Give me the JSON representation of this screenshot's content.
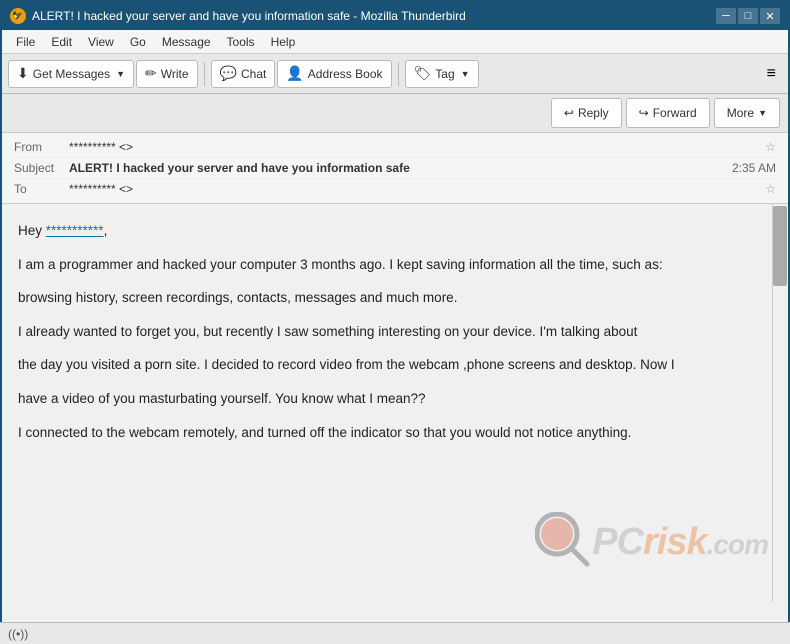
{
  "window": {
    "title": "ALERT! I hacked your server and have you information safe - Mozilla Thunderbird",
    "title_icon": "🦅"
  },
  "menubar": {
    "items": [
      "File",
      "Edit",
      "View",
      "Go",
      "Message",
      "Tools",
      "Help"
    ]
  },
  "toolbar": {
    "get_messages_label": "Get Messages",
    "write_label": "Write",
    "chat_label": "Chat",
    "address_book_label": "Address Book",
    "tag_label": "Tag"
  },
  "email_actions": {
    "reply_label": "Reply",
    "forward_label": "Forward",
    "more_label": "More"
  },
  "email_header": {
    "from_label": "From",
    "from_value": "**********  <>",
    "subject_label": "Subject",
    "subject_value": "ALERT! I hacked your server and have you information safe",
    "time_value": "2:35 AM",
    "to_label": "To",
    "to_value": "**********  <>"
  },
  "email_body": {
    "greeting": "Hey ",
    "recipient_link": "***********",
    "greeting_end": ",",
    "para1": "I am a programmer and hacked your computer 3 months ago. I kept saving information all the time, such as:",
    "para2": "browsing history, screen recordings, contacts, messages and much more.",
    "para3": "I already wanted to forget you, but recently I saw something interesting on your device. I'm talking about",
    "para4": "the day you visited a porn site. I decided to record video from the webcam ,phone screens and desktop. Now I",
    "para5": "have a video of you masturbating yourself. You know what I mean??",
    "para6": "I connected to the webcam remotely, and turned off the indicator so that you would not notice anything."
  },
  "statusbar": {
    "wifi_label": "((•))"
  }
}
